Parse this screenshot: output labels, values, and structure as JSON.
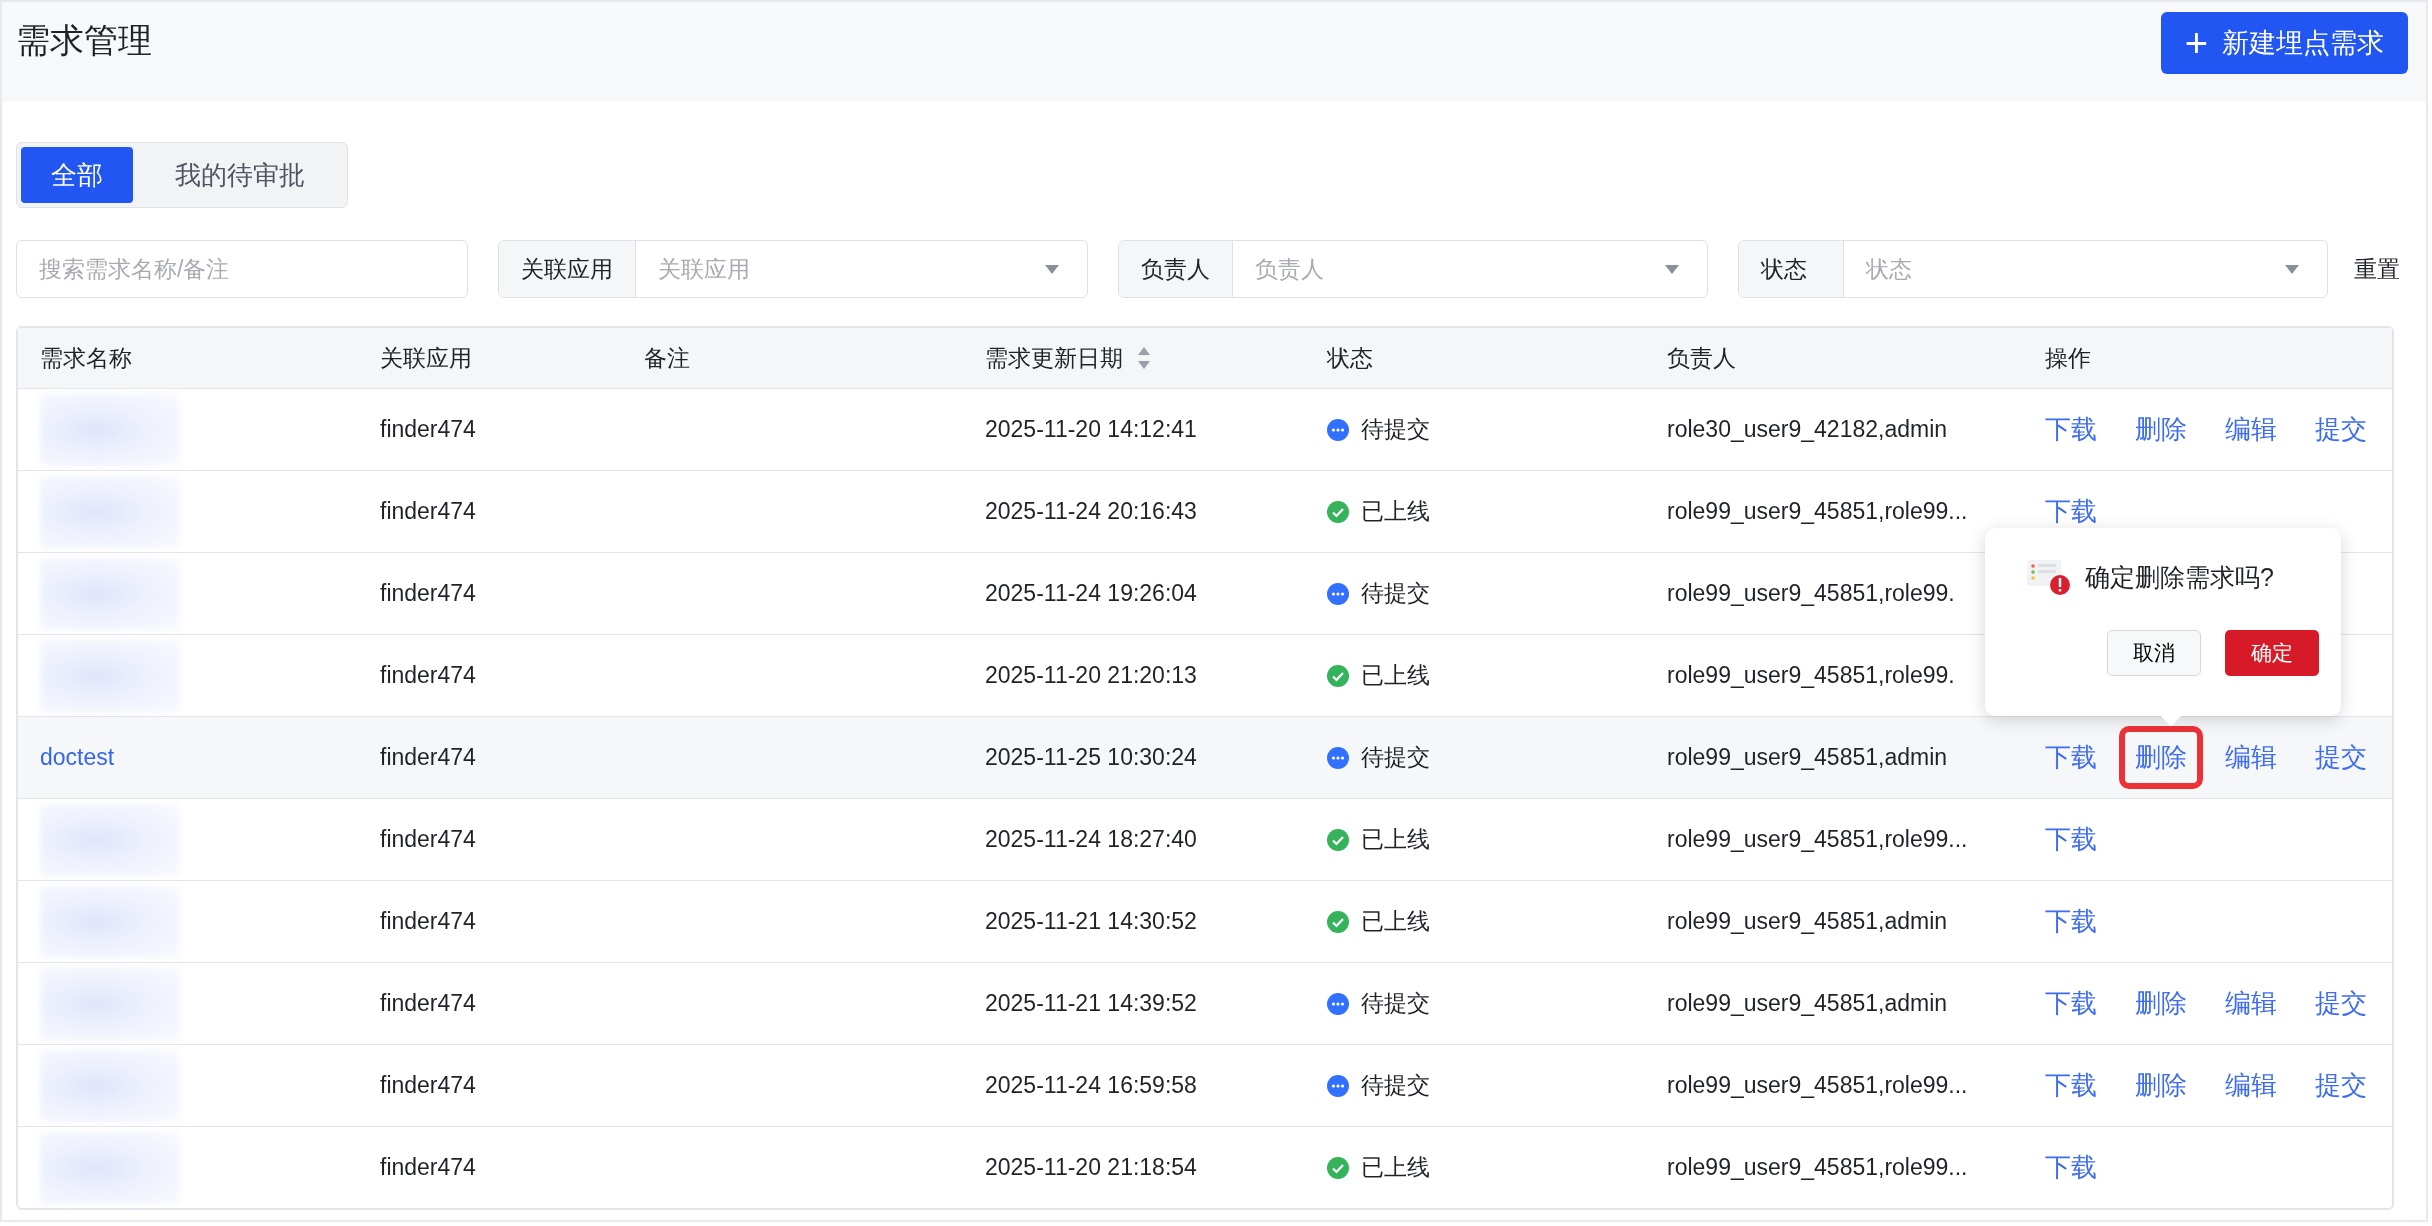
{
  "page_title": "需求管理",
  "new_button": {
    "icon": "+",
    "label": "新建埋点需求"
  },
  "tabs": [
    {
      "label": "全部",
      "selected": true
    },
    {
      "label": "我的待审批",
      "selected": false
    }
  ],
  "search": {
    "placeholder": "搜索需求名称/备注"
  },
  "filters": [
    {
      "label": "关联应用",
      "placeholder": "关联应用"
    },
    {
      "label": "负责人",
      "placeholder": "负责人"
    },
    {
      "label": "状态",
      "placeholder": "状态"
    }
  ],
  "reset_link": "重置",
  "table": {
    "columns": [
      {
        "label": "需求名称",
        "sortable": false
      },
      {
        "label": "关联应用",
        "sortable": false
      },
      {
        "label": "备注",
        "sortable": false
      },
      {
        "label": "需求更新日期",
        "sortable": true
      },
      {
        "label": "状态",
        "sortable": false
      },
      {
        "label": "负责人",
        "sortable": false
      },
      {
        "label": "操作",
        "sortable": false
      }
    ],
    "rows": [
      {
        "redacted": true,
        "app": "finder474",
        "updated": "2025-11-20 14:12:41",
        "status": {
          "kind": "pending",
          "text": "待提交"
        },
        "owner": "role30_user9_42182,admin",
        "hovered": false,
        "actions": [
          {
            "kind": "download",
            "label": "下载",
            "annotated": false
          },
          {
            "kind": "delete",
            "label": "删除",
            "annotated": false
          },
          {
            "kind": "edit",
            "label": "编辑",
            "annotated": false
          },
          {
            "kind": "submit",
            "label": "提交",
            "annotated": false
          }
        ]
      },
      {
        "redacted": true,
        "app": "finder474",
        "updated": "2025-11-24 20:16:43",
        "status": {
          "kind": "online",
          "text": "已上线"
        },
        "owner": "role99_user9_45851,role99...",
        "hovered": false,
        "actions": [
          {
            "kind": "download",
            "label": "下载",
            "annotated": false
          }
        ]
      },
      {
        "redacted": true,
        "app": "finder474",
        "updated": "2025-11-24 19:26:04",
        "status": {
          "kind": "pending",
          "text": "待提交"
        },
        "owner": "role99_user9_45851,role99.",
        "hovered": false,
        "actions": []
      },
      {
        "redacted": true,
        "app": "finder474",
        "updated": "2025-11-20 21:20:13",
        "status": {
          "kind": "online",
          "text": "已上线"
        },
        "owner": "role99_user9_45851,role99.",
        "hovered": false,
        "actions": []
      },
      {
        "redacted": false,
        "name": "doctest",
        "app": "finder474",
        "updated": "2025-11-25 10:30:24",
        "status": {
          "kind": "pending",
          "text": "待提交"
        },
        "owner": "role99_user9_45851,admin",
        "hovered": true,
        "actions": [
          {
            "kind": "download",
            "label": "下载",
            "annotated": false
          },
          {
            "kind": "delete",
            "label": "删除",
            "annotated": true
          },
          {
            "kind": "edit",
            "label": "编辑",
            "annotated": false
          },
          {
            "kind": "submit",
            "label": "提交",
            "annotated": false
          }
        ]
      },
      {
        "redacted": true,
        "app": "finder474",
        "updated": "2025-11-24 18:27:40",
        "status": {
          "kind": "online",
          "text": "已上线"
        },
        "owner": "role99_user9_45851,role99...",
        "hovered": false,
        "actions": [
          {
            "kind": "download",
            "label": "下载",
            "annotated": false
          }
        ]
      },
      {
        "redacted": true,
        "app": "finder474",
        "updated": "2025-11-21 14:30:52",
        "status": {
          "kind": "online",
          "text": "已上线"
        },
        "owner": "role99_user9_45851,admin",
        "hovered": false,
        "actions": [
          {
            "kind": "download",
            "label": "下载",
            "annotated": false
          }
        ]
      },
      {
        "redacted": true,
        "app": "finder474",
        "updated": "2025-11-21 14:39:52",
        "status": {
          "kind": "pending",
          "text": "待提交"
        },
        "owner": "role99_user9_45851,admin",
        "hovered": false,
        "actions": [
          {
            "kind": "download",
            "label": "下载",
            "annotated": false
          },
          {
            "kind": "delete",
            "label": "删除",
            "annotated": false
          },
          {
            "kind": "edit",
            "label": "编辑",
            "annotated": false
          },
          {
            "kind": "submit",
            "label": "提交",
            "annotated": false
          }
        ]
      },
      {
        "redacted": true,
        "app": "finder474",
        "updated": "2025-11-24 16:59:58",
        "status": {
          "kind": "pending",
          "text": "待提交"
        },
        "owner": "role99_user9_45851,role99...",
        "hovered": false,
        "actions": [
          {
            "kind": "download",
            "label": "下载",
            "annotated": false
          },
          {
            "kind": "delete",
            "label": "删除",
            "annotated": false
          },
          {
            "kind": "edit",
            "label": "编辑",
            "annotated": false
          },
          {
            "kind": "submit",
            "label": "提交",
            "annotated": false
          }
        ]
      },
      {
        "redacted": true,
        "app": "finder474",
        "updated": "2025-11-20 21:18:54",
        "status": {
          "kind": "online",
          "text": "已上线"
        },
        "owner": "role99_user9_45851,role99...",
        "hovered": false,
        "actions": [
          {
            "kind": "download",
            "label": "下载",
            "annotated": false
          }
        ]
      }
    ]
  },
  "confirm_popover": {
    "message": "确定删除需求吗?",
    "cancel": "取消",
    "confirm": "确定"
  }
}
